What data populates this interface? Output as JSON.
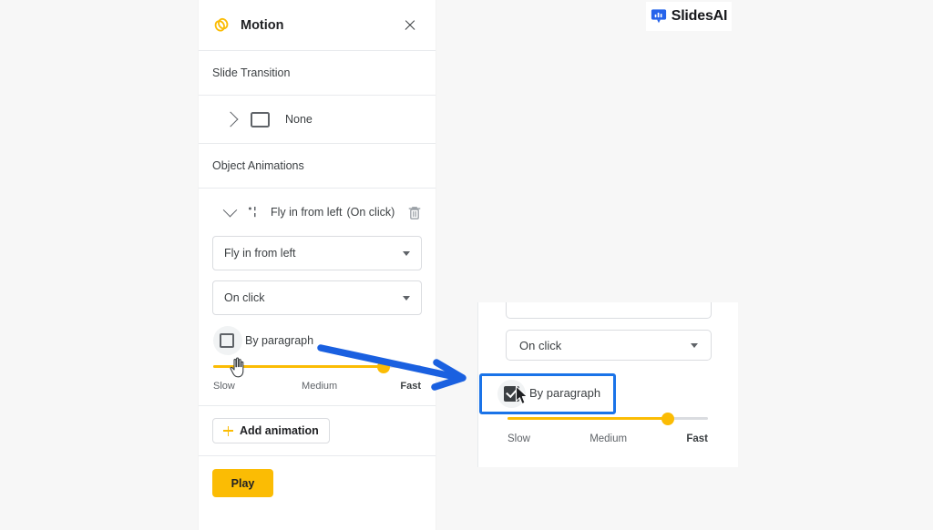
{
  "brand": {
    "logo_text": "SlidesAI",
    "logo_icon": "slides-presentation-icon",
    "logo_accent": "#2563eb"
  },
  "colors": {
    "accent_yellow": "#fbbc04",
    "highlight_blue": "#1a73e8",
    "arrow_blue": "#1a60e0",
    "text_primary": "#3c4043",
    "text_secondary": "#5f6368",
    "border": "#dadce0",
    "page_background": "#f7f7f7"
  },
  "panel": {
    "title": "Motion",
    "title_icon": "motion-coins-icon",
    "close_icon": "close-icon",
    "slide_transition": {
      "label": "Slide Transition",
      "expand_icon": "chevron-right-icon",
      "type_icon": "slide-rectangle-icon",
      "value": "None"
    },
    "object_animations": {
      "label": "Object Animations",
      "item": {
        "collapse_icon": "chevron-down-icon",
        "list_icon": "bullet-list-icon",
        "name": "Fly in from left",
        "trigger": "(On click)",
        "delete_icon": "trash-icon"
      },
      "effect_select": {
        "value": "Fly in from left",
        "caret_icon": "chevron-down-icon"
      },
      "trigger_select": {
        "value": "On click",
        "caret_icon": "chevron-down-icon"
      },
      "by_paragraph": {
        "label": "By paragraph",
        "checked": false
      },
      "speed_slider": {
        "value_percent": 82,
        "min_label": "Slow",
        "mid_label": "Medium",
        "max_label": "Fast"
      }
    },
    "add_animation": {
      "label": "Add animation",
      "icon": "plus-icon"
    },
    "play_button": {
      "label": "Play"
    }
  },
  "zoom_callout": {
    "trigger_select": {
      "value": "On click",
      "caret_icon": "chevron-down-icon"
    },
    "by_paragraph": {
      "label": "By paragraph",
      "checked": true
    },
    "speed_slider": {
      "value_percent": 80,
      "min_label": "Slow",
      "mid_label": "Medium",
      "max_label": "Fast"
    }
  },
  "annotation": {
    "arrow_icon": "blue-pointer-arrow",
    "cursor_icon": "pointing-hand-cursor"
  }
}
